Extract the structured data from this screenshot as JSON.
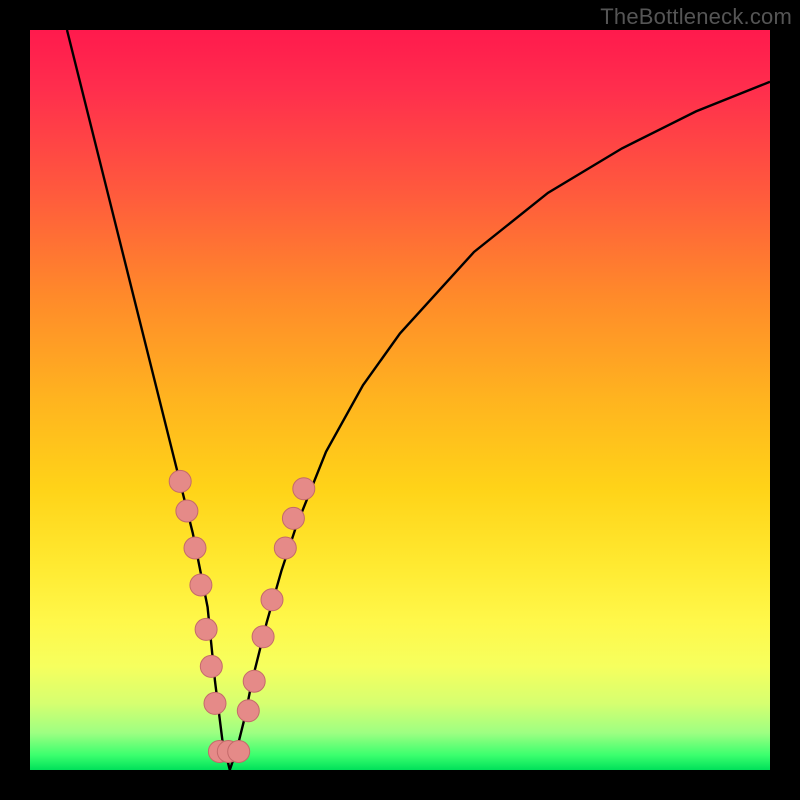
{
  "watermark": {
    "text": "TheBottleneck.com"
  },
  "colors": {
    "frame": "#000000",
    "curve": "#000000",
    "marker_fill": "#e58a88",
    "marker_stroke": "#c46a6a"
  },
  "chart_data": {
    "type": "line",
    "title": "",
    "xlabel": "",
    "ylabel": "",
    "xlim": [
      0,
      100
    ],
    "ylim": [
      0,
      100
    ],
    "grid": false,
    "legend": false,
    "note": "V-shaped bottleneck curve; minimum at ~x=27, y≈0. Values are % of plot area, top-left origin.",
    "series": [
      {
        "name": "bottleneck-curve",
        "x": [
          5,
          10,
          14,
          18,
          20,
          22,
          24,
          25,
          26,
          27,
          28,
          29,
          30,
          32,
          34,
          36,
          40,
          45,
          50,
          60,
          70,
          80,
          90,
          100
        ],
        "y_top": [
          0,
          20,
          36,
          52,
          60,
          68,
          78,
          88,
          96,
          100,
          97,
          93,
          88,
          80,
          73,
          67,
          57,
          48,
          41,
          30,
          22,
          16,
          11,
          7
        ]
      }
    ],
    "markers": {
      "name": "highlighted-points",
      "points_pct": [
        {
          "x": 20.3,
          "y_top": 61
        },
        {
          "x": 21.2,
          "y_top": 65
        },
        {
          "x": 22.3,
          "y_top": 70
        },
        {
          "x": 23.1,
          "y_top": 75
        },
        {
          "x": 23.8,
          "y_top": 81
        },
        {
          "x": 24.5,
          "y_top": 86
        },
        {
          "x": 25.0,
          "y_top": 91
        },
        {
          "x": 25.6,
          "y_top": 97.5
        },
        {
          "x": 26.8,
          "y_top": 97.5
        },
        {
          "x": 28.2,
          "y_top": 97.5
        },
        {
          "x": 29.5,
          "y_top": 92
        },
        {
          "x": 30.3,
          "y_top": 88
        },
        {
          "x": 31.5,
          "y_top": 82
        },
        {
          "x": 32.7,
          "y_top": 77
        },
        {
          "x": 34.5,
          "y_top": 70
        },
        {
          "x": 35.6,
          "y_top": 66
        },
        {
          "x": 37.0,
          "y_top": 62
        }
      ]
    }
  }
}
